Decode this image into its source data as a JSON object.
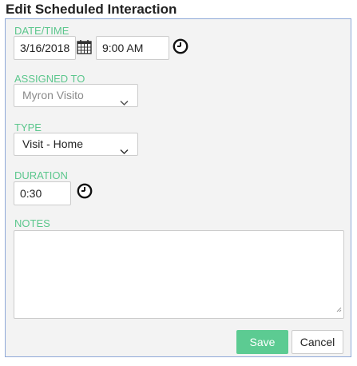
{
  "dialog": {
    "title": "Edit Scheduled Interaction"
  },
  "fields": {
    "datetime": {
      "label": "DATE/TIME",
      "date_value": "3/16/2018",
      "time_value": "9:00 AM",
      "calendar_icon": "calendar-icon",
      "clock_icon": "clock-icon"
    },
    "assigned_to": {
      "label": "ASSIGNED TO",
      "value": "Myron Visito",
      "disabled": true
    },
    "type": {
      "label": "TYPE",
      "value": "Visit - Home"
    },
    "duration": {
      "label": "DURATION",
      "value": "0:30",
      "clock_icon": "clock-icon"
    },
    "notes": {
      "label": "NOTES",
      "value": ""
    }
  },
  "actions": {
    "save_label": "Save",
    "cancel_label": "Cancel"
  },
  "colors": {
    "label_green": "#5cc78d",
    "save_button": "#5ccb92",
    "panel_border": "#8fa9d8",
    "panel_background": "#f3f3f3"
  }
}
